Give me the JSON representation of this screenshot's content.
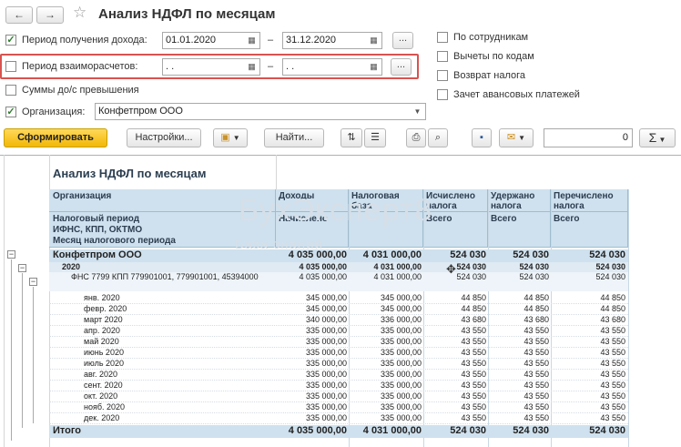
{
  "header": {
    "back": "←",
    "forward": "→",
    "title": "Анализ НДФЛ по месяцам"
  },
  "filters": {
    "period_income": {
      "label": "Период получения дохода:",
      "checked": true,
      "from": "01.01.2020",
      "to": "31.12.2020"
    },
    "period_settlement": {
      "label": "Период взаиморасчетов:",
      "checked": false,
      "from": " .  .",
      "to": " .  ."
    },
    "sums_excess": {
      "label": "Суммы до/с превышения",
      "checked": false
    },
    "organization": {
      "label": "Организация:",
      "checked": true,
      "value": "Конфетпром ООО"
    },
    "dash": "–",
    "dots": "..."
  },
  "options": [
    "По сотрудникам",
    "Вычеты по кодам",
    "Возврат налога",
    "Зачет авансовых платежей"
  ],
  "toolbar": {
    "generate": "Сформировать",
    "settings": "Настройки...",
    "find": "Найти...",
    "counter": "0",
    "sigma": "Σ"
  },
  "report": {
    "title": "Анализ НДФЛ по месяцам",
    "watermark": "БухЭксперт8",
    "watermark_sub": "База     знаний",
    "headers": {
      "org": "Организация",
      "period": "Налоговый период",
      "ifns": "ИФНС, КПП, ОКТМО",
      "month": "Месяц налогового периода",
      "income": "Доходы",
      "income_sub": "Начислено",
      "base": "Налоговая база",
      "calc": "Исчислено налога",
      "calc_sub": "Всего",
      "withheld": "Удержано налога",
      "withheld_sub": "Всего",
      "transferred": "Перечислено налога",
      "transferred_sub": "Всего"
    },
    "rows": [
      {
        "label": "Конфетпром ООО",
        "income": "4 035 000,00",
        "base": "4 031 000,00",
        "calc": "524 030",
        "withheld": "524 030",
        "transferred": "524 030"
      },
      {
        "label": "2020",
        "income": "4 035 000,00",
        "base": "4 031 000,00",
        "calc": "524 030",
        "withheld": "524 030",
        "transferred": "524 030"
      },
      {
        "label": "ФНС 7799 КПП 779901001, 779901001, 45394000",
        "income": "4 035 000,00",
        "base": "4 031 000,00",
        "calc": "524 030",
        "withheld": "524 030",
        "transferred": "524 030"
      },
      {
        "label": "янв. 2020",
        "income": "345 000,00",
        "base": "345 000,00",
        "calc": "44 850",
        "withheld": "44 850",
        "transferred": "44 850"
      },
      {
        "label": "февр. 2020",
        "income": "345 000,00",
        "base": "345 000,00",
        "calc": "44 850",
        "withheld": "44 850",
        "transferred": "44 850"
      },
      {
        "label": "март 2020",
        "income": "340 000,00",
        "base": "336 000,00",
        "calc": "43 680",
        "withheld": "43 680",
        "transferred": "43 680"
      },
      {
        "label": "апр. 2020",
        "income": "335 000,00",
        "base": "335 000,00",
        "calc": "43 550",
        "withheld": "43 550",
        "transferred": "43 550"
      },
      {
        "label": "май 2020",
        "income": "335 000,00",
        "base": "335 000,00",
        "calc": "43 550",
        "withheld": "43 550",
        "transferred": "43 550"
      },
      {
        "label": "июнь 2020",
        "income": "335 000,00",
        "base": "335 000,00",
        "calc": "43 550",
        "withheld": "43 550",
        "transferred": "43 550"
      },
      {
        "label": "июль 2020",
        "income": "335 000,00",
        "base": "335 000,00",
        "calc": "43 550",
        "withheld": "43 550",
        "transferred": "43 550"
      },
      {
        "label": "авг. 2020",
        "income": "335 000,00",
        "base": "335 000,00",
        "calc": "43 550",
        "withheld": "43 550",
        "transferred": "43 550"
      },
      {
        "label": "сент. 2020",
        "income": "335 000,00",
        "base": "335 000,00",
        "calc": "43 550",
        "withheld": "43 550",
        "transferred": "43 550"
      },
      {
        "label": "окт. 2020",
        "income": "335 000,00",
        "base": "335 000,00",
        "calc": "43 550",
        "withheld": "43 550",
        "transferred": "43 550"
      },
      {
        "label": "нояб. 2020",
        "income": "335 000,00",
        "base": "335 000,00",
        "calc": "43 550",
        "withheld": "43 550",
        "transferred": "43 550"
      },
      {
        "label": "дек. 2020",
        "income": "335 000,00",
        "base": "335 000,00",
        "calc": "43 550",
        "withheld": "43 550",
        "transferred": "43 550"
      },
      {
        "label": "Итого",
        "income": "4 035 000,00",
        "base": "4 031 000,00",
        "calc": "524 030",
        "withheld": "524 030",
        "transferred": "524 030"
      }
    ]
  }
}
